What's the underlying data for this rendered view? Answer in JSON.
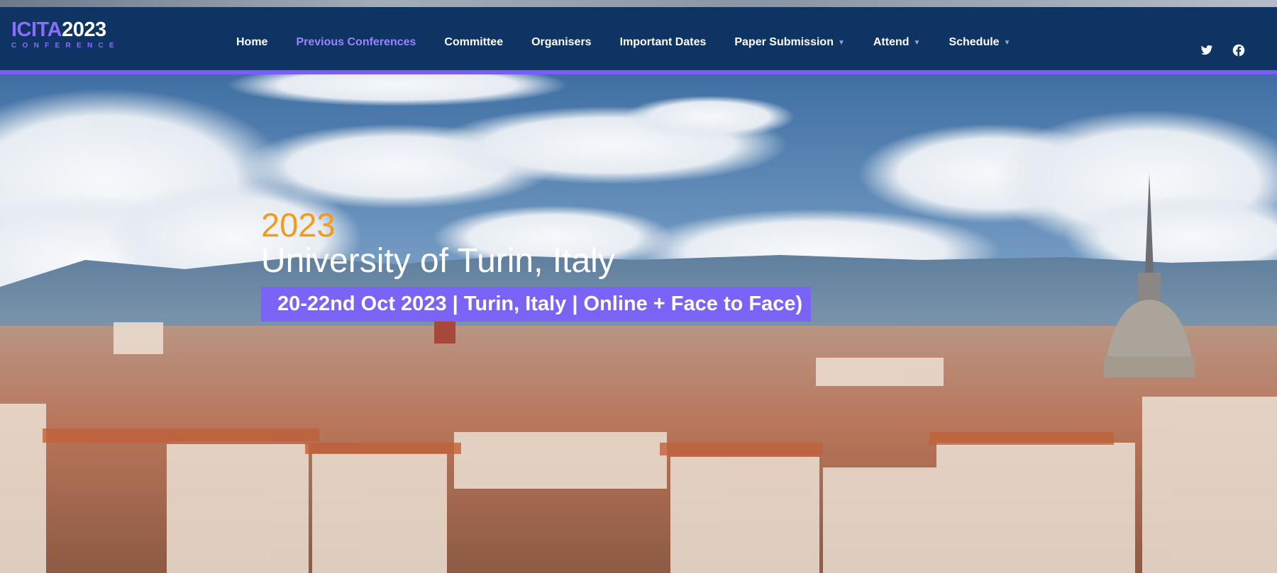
{
  "logo": {
    "part1": "ICITA",
    "part2": "2023",
    "subtitle": "CONFERENCE"
  },
  "nav": {
    "items": [
      {
        "label": "Home",
        "active": false,
        "dropdown": false
      },
      {
        "label": "Previous Conferences",
        "active": true,
        "dropdown": false
      },
      {
        "label": "Committee",
        "active": false,
        "dropdown": false
      },
      {
        "label": "Organisers",
        "active": false,
        "dropdown": false
      },
      {
        "label": "Important Dates",
        "active": false,
        "dropdown": false
      },
      {
        "label": "Paper Submission",
        "active": false,
        "dropdown": true
      },
      {
        "label": "Attend",
        "active": false,
        "dropdown": true
      },
      {
        "label": "Schedule",
        "active": false,
        "dropdown": true
      }
    ]
  },
  "social": {
    "icons": [
      "twitter-icon",
      "facebook-icon"
    ]
  },
  "hero": {
    "year": "2023",
    "venue": "University of Turin, Italy",
    "banner": "20-22nd Oct 2023 | Turin, Italy | Online + Face to Face)"
  },
  "colors": {
    "navbar": "#0e3463",
    "accent": "#7b5cf7",
    "active_link": "#9a83ff",
    "year": "#f39a1b",
    "banner": "#7b63f5"
  }
}
